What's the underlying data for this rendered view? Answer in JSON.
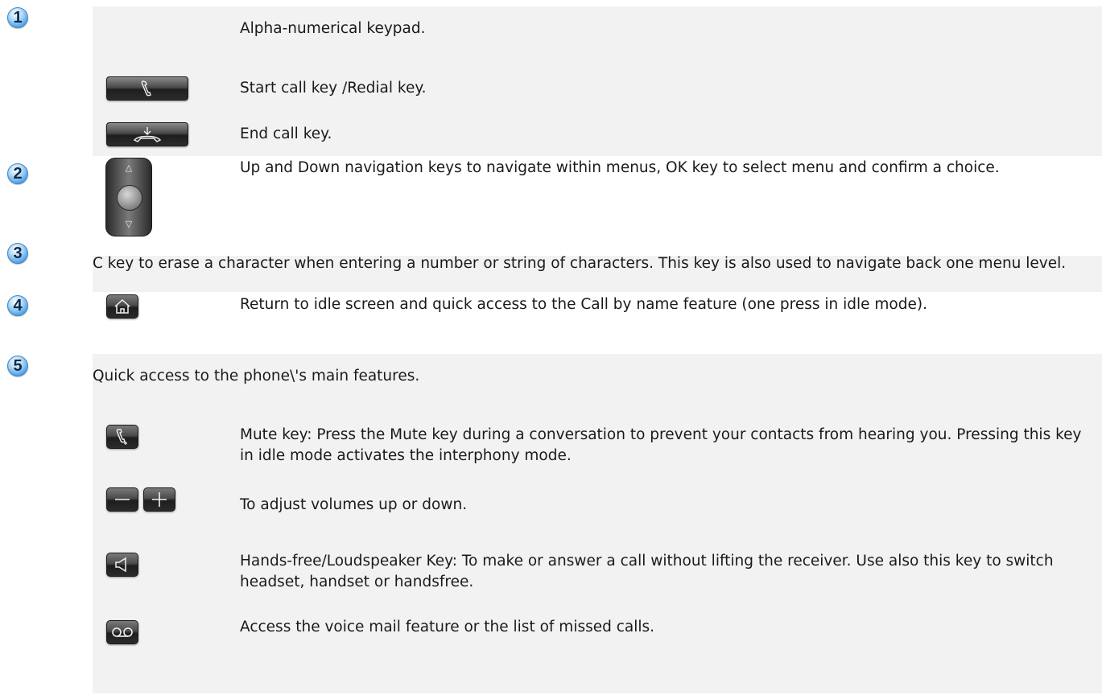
{
  "badges": [
    "1",
    "2",
    "3",
    "4",
    "5"
  ],
  "items": {
    "keypad": "Alpha-numerical keypad.",
    "start_call": "Start call key /Redial key.",
    "end_call": "End call key.",
    "navigation": "Up and Down navigation keys to navigate within menus, OK key to select menu and confirm a choice.",
    "c_key": "C key to erase a character when entering a number or string of characters. This key is also used to navigate back one menu level.",
    "home": "Return to idle screen and quick access to the Call by name feature (one press in idle mode).",
    "quick_access": "Quick access to the phone\\'s main features.",
    "mute": "Mute key: Press the Mute key during a conversation to prevent your contacts from hearing you. Pressing this key in idle mode activates the interphony mode.",
    "volume": "To adjust volumes up or down.",
    "handsfree": "Hands-free/Loudspeaker Key: To make or answer a call without lifting the receiver. Use also this key to switch headset, handset or handsfree.",
    "voicemail": "Access the voice mail feature or the list of missed calls."
  },
  "icons": {
    "start_call": "handset-icon",
    "end_call": "hang-up-icon",
    "navigation": "navigator-icon",
    "home": "home-icon",
    "mute": "mute-icon",
    "volume_down": "minus-icon",
    "volume_up": "plus-icon",
    "handsfree": "speaker-icon",
    "voicemail": "voicemail-icon"
  },
  "colors": {
    "badge": "#5aa9ea",
    "section_bg": "#f2f2f2",
    "key_dark": "#2a2a2a"
  }
}
